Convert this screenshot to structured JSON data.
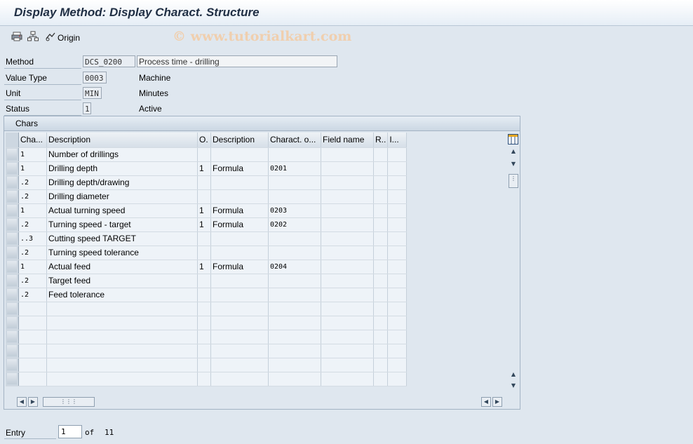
{
  "window": {
    "title": "Display Method: Display Charact. Structure"
  },
  "toolbar": {
    "origin_label": "Origin",
    "watermark": "© www.tutorialkart.com"
  },
  "header": {
    "method_label": "Method",
    "method_value": "DCS_0200",
    "method_desc": "Process time - drilling",
    "value_type_label": "Value Type",
    "value_type_value": "0003",
    "value_type_desc": "Machine",
    "unit_label": "Unit",
    "unit_value": "MIN",
    "unit_desc": "Minutes",
    "status_label": "Status",
    "status_value": "1",
    "status_desc": "Active"
  },
  "chars": {
    "title": "Chars",
    "columns": [
      "Cha...",
      "Description",
      "O.",
      "Description",
      "Charact. o...",
      "Field name",
      "R..",
      "I..."
    ],
    "rows": [
      [
        "1",
        "Number of drillings",
        "",
        "",
        "",
        "",
        "",
        ""
      ],
      [
        "1",
        "Drilling depth",
        "1",
        "Formula",
        "0201",
        "",
        "",
        ""
      ],
      [
        ".2",
        "Drilling depth/drawing",
        "",
        "",
        "",
        "",
        "",
        ""
      ],
      [
        ".2",
        "Drilling diameter",
        "",
        "",
        "",
        "",
        "",
        ""
      ],
      [
        "1",
        "Actual turning speed",
        "1",
        "Formula",
        "0203",
        "",
        "",
        ""
      ],
      [
        ".2",
        "Turning speed - target",
        "1",
        "Formula",
        "0202",
        "",
        "",
        ""
      ],
      [
        "..3",
        "Cutting speed TARGET",
        "",
        "",
        "",
        "",
        "",
        ""
      ],
      [
        ".2",
        "Turning speed tolerance",
        "",
        "",
        "",
        "",
        "",
        ""
      ],
      [
        "1",
        "Actual feed",
        "1",
        "Formula",
        "0204",
        "",
        "",
        ""
      ],
      [
        ".2",
        "Target feed",
        "",
        "",
        "",
        "",
        "",
        ""
      ],
      [
        ".2",
        "Feed tolerance",
        "",
        "",
        "",
        "",
        "",
        ""
      ]
    ],
    "empty_rows": 6
  },
  "footer": {
    "entry_label": "Entry",
    "entry_value": "1",
    "of_label": "of",
    "total": "11"
  },
  "icons": [
    "print-icon",
    "hierarchy-icon",
    "origin-icon",
    "column-config-icon",
    "scroll-up-icon",
    "scroll-down-icon",
    "scroll-left-icon",
    "scroll-right-icon"
  ]
}
